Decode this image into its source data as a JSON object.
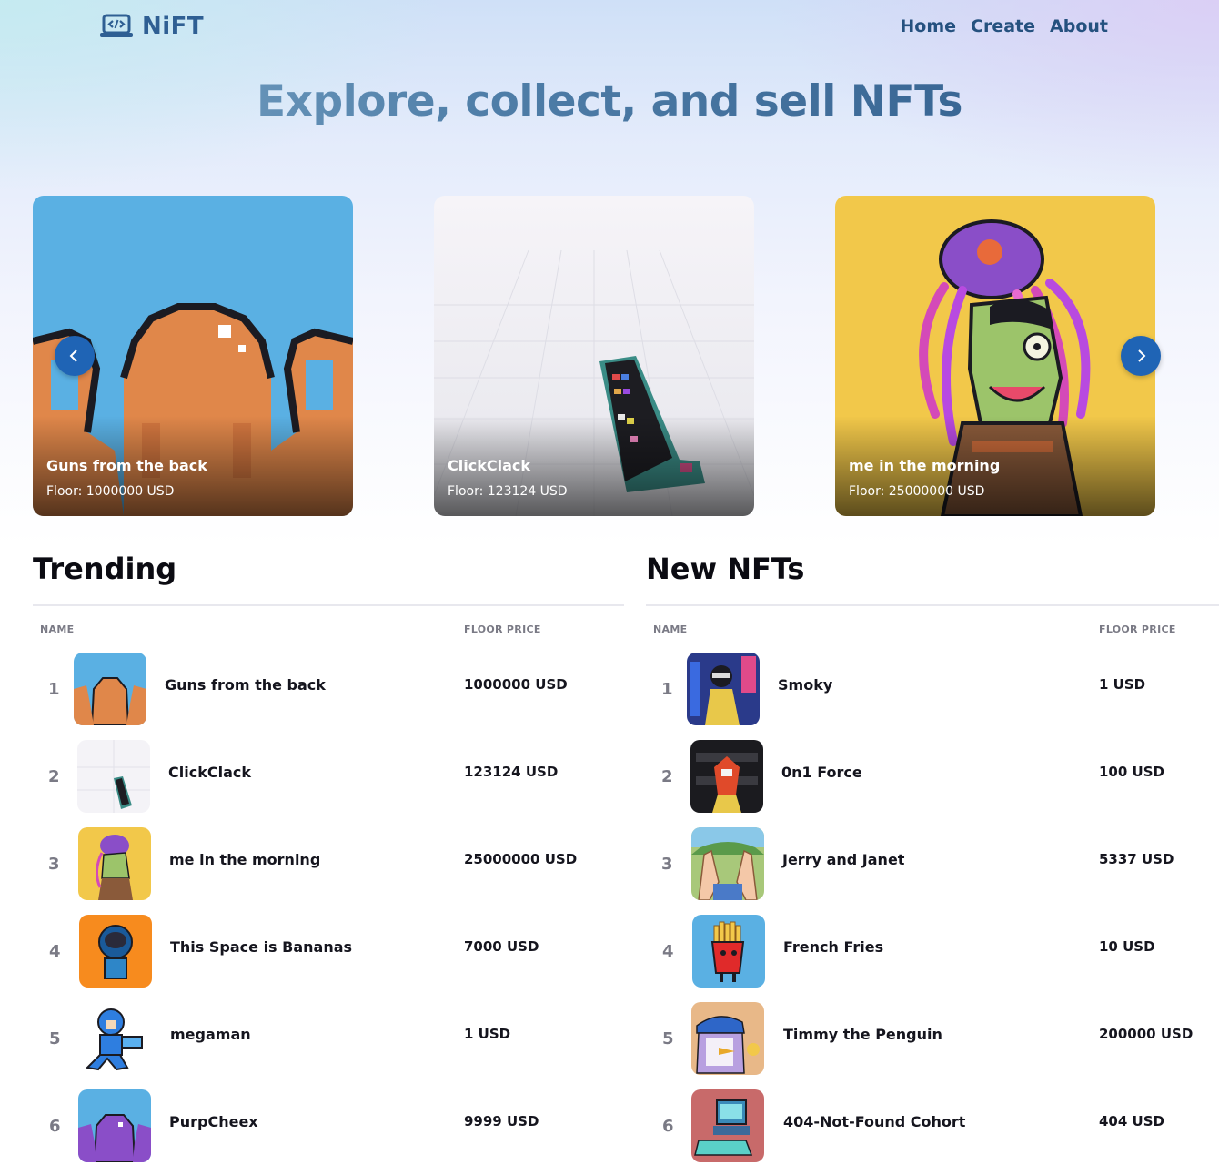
{
  "brand": {
    "name": "NiFT"
  },
  "nav": [
    {
      "label": "Home"
    },
    {
      "label": "Create"
    },
    {
      "label": "About"
    }
  ],
  "hero": {
    "headline": "Explore, collect, and sell NFTs"
  },
  "carousel": {
    "cards": [
      {
        "title": "Guns from the back",
        "floor": "Floor: 1000000 USD"
      },
      {
        "title": "ClickClack",
        "floor": "Floor: 123124 USD"
      },
      {
        "title": "me in the morning",
        "floor": "Floor: 25000000 USD"
      }
    ]
  },
  "trending": {
    "title": "Trending",
    "col_name": "NAME",
    "col_price": "FLOOR PRICE",
    "rows": [
      {
        "rank": "1",
        "name": "Guns from the back",
        "price": "1000000 USD"
      },
      {
        "rank": "2",
        "name": "ClickClack",
        "price": "123124 USD"
      },
      {
        "rank": "3",
        "name": "me in the morning",
        "price": "25000000 USD"
      },
      {
        "rank": "4",
        "name": "This Space is Bananas",
        "price": "7000 USD"
      },
      {
        "rank": "5",
        "name": "megaman",
        "price": "1 USD"
      },
      {
        "rank": "6",
        "name": "PurpCheex",
        "price": "9999 USD"
      }
    ]
  },
  "new_nfts": {
    "title": "New NFTs",
    "col_name": "NAME",
    "col_price": "FLOOR PRICE",
    "rows": [
      {
        "rank": "1",
        "name": "Smoky",
        "price": "1 USD"
      },
      {
        "rank": "2",
        "name": "0n1 Force",
        "price": "100 USD"
      },
      {
        "rank": "3",
        "name": "Jerry and Janet",
        "price": "5337 USD"
      },
      {
        "rank": "4",
        "name": "French Fries",
        "price": "10 USD"
      },
      {
        "rank": "5",
        "name": "Timmy the Penguin",
        "price": "200000 USD"
      },
      {
        "rank": "6",
        "name": "404-Not-Found Cohort",
        "price": "404 USD"
      }
    ]
  }
}
